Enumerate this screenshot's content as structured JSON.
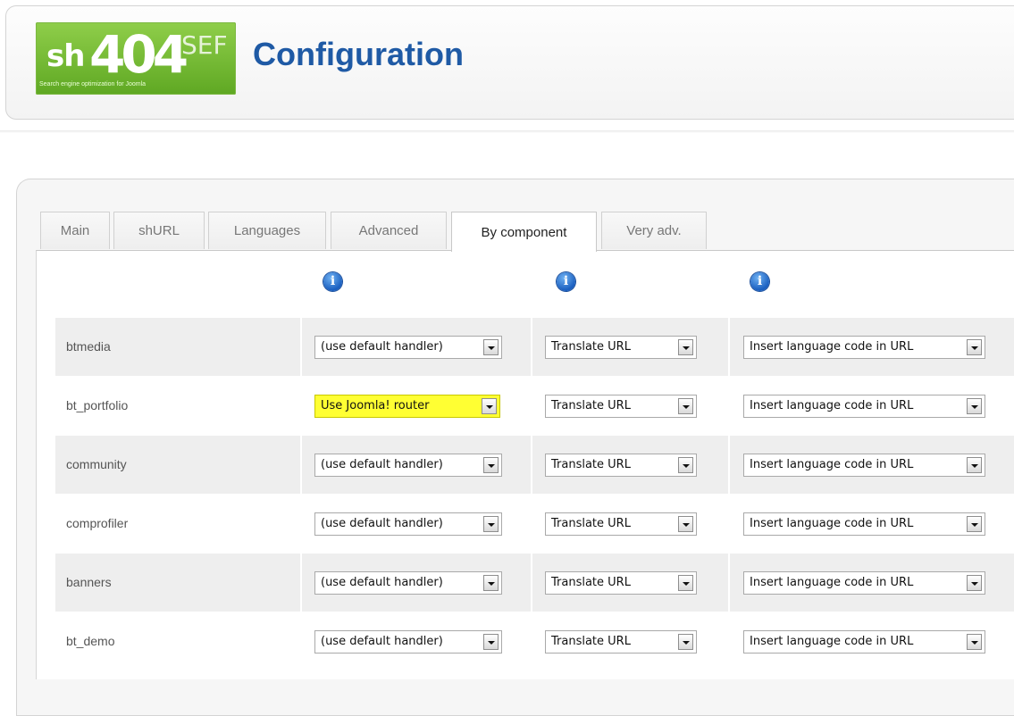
{
  "header": {
    "logo": {
      "sh": "sh",
      "num": "404",
      "sef": "SEF",
      "tagline": "Search engine optimization for Joomla"
    },
    "title": "Configuration"
  },
  "tabs": [
    {
      "label": "Main",
      "active": false
    },
    {
      "label": "shURL",
      "active": false
    },
    {
      "label": "Languages",
      "active": false
    },
    {
      "label": "Advanced",
      "active": false
    },
    {
      "label": "By component",
      "active": true
    },
    {
      "label": "Very adv.",
      "active": false
    }
  ],
  "columns": {
    "info_icon": "info-icon",
    "info_glyph": "i"
  },
  "rows": [
    {
      "name": "btmedia",
      "handler": "(use default handler)",
      "translate": "Translate URL",
      "language": "Insert language code in URL"
    },
    {
      "name": "bt_portfolio",
      "handler": "Use Joomla! router",
      "translate": "Translate URL",
      "language": "Insert language code in URL",
      "highlight": true
    },
    {
      "name": "community",
      "handler": "(use default handler)",
      "translate": "Translate URL",
      "language": "Insert language code in URL"
    },
    {
      "name": "comprofiler",
      "handler": "(use default handler)",
      "translate": "Translate URL",
      "language": "Insert language code in URL"
    },
    {
      "name": "banners",
      "handler": "(use default handler)",
      "translate": "Translate URL",
      "language": "Insert language code in URL"
    },
    {
      "name": "bt_demo",
      "handler": "(use default handler)",
      "translate": "Translate URL",
      "language": "Insert language code in URL"
    }
  ],
  "colors": {
    "title": "#1f5aa5",
    "logo_green": "#6fb82e",
    "highlight": "#ffff33"
  }
}
